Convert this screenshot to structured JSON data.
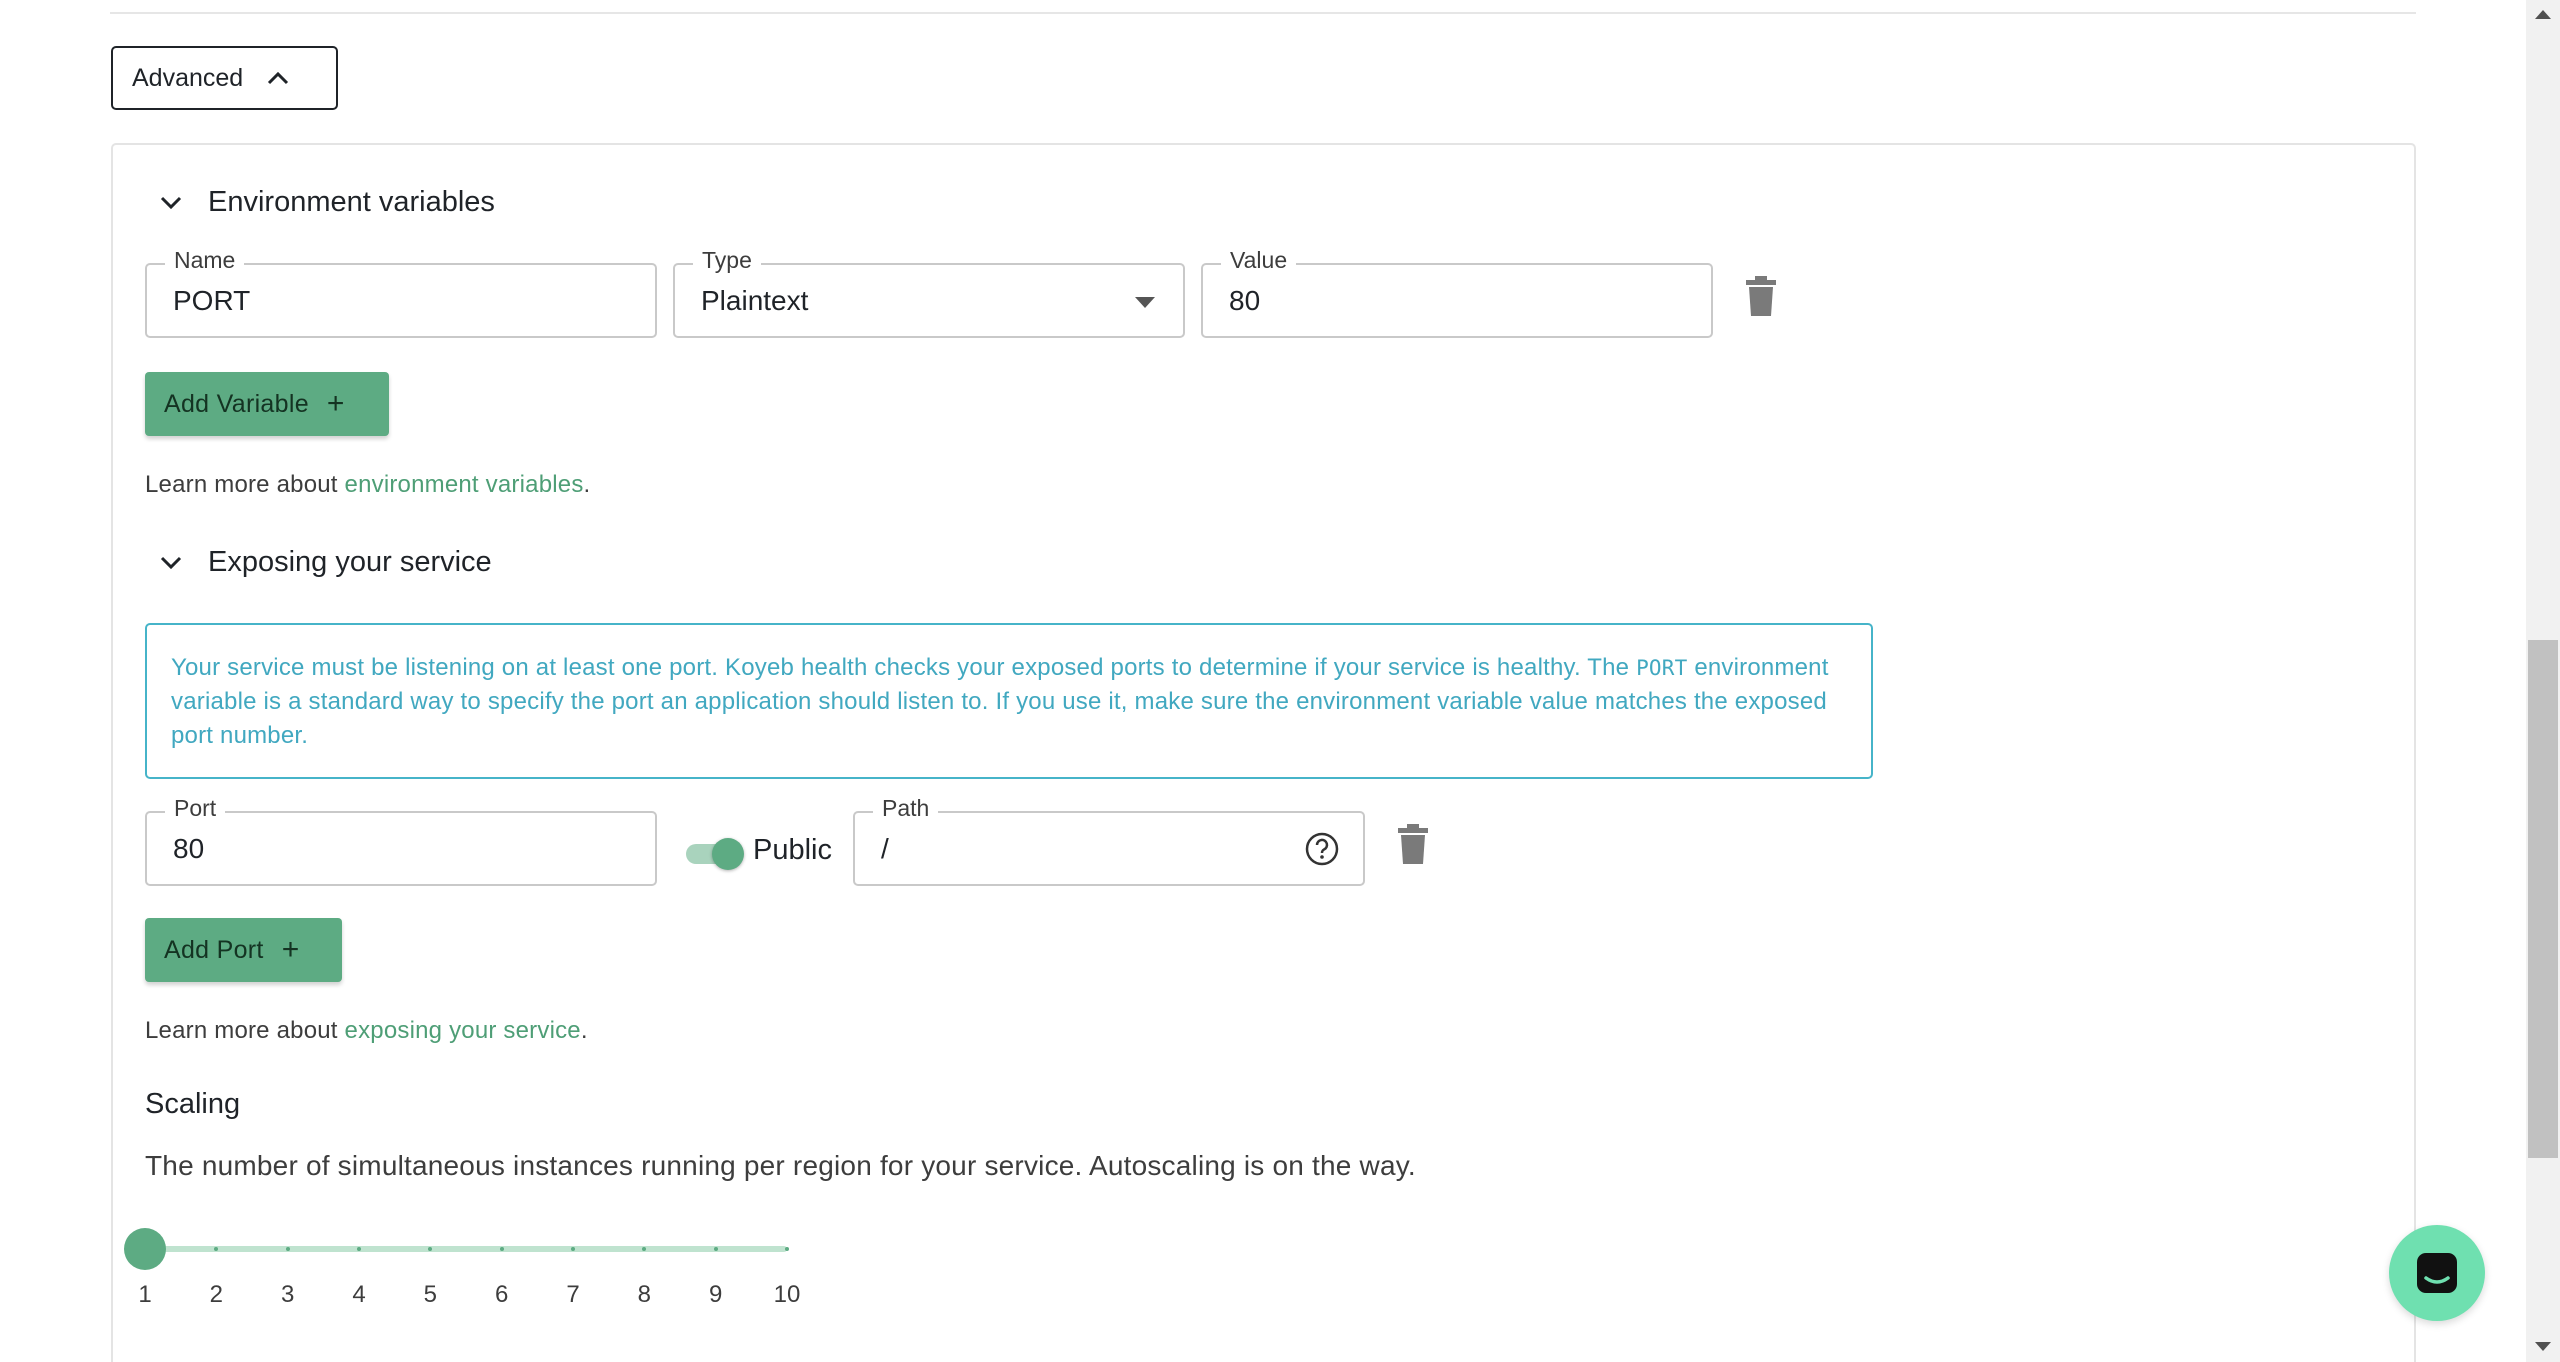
{
  "advanced": {
    "label": "Advanced"
  },
  "env": {
    "title": "Environment variables",
    "name_label": "Name",
    "name_value": "PORT",
    "type_label": "Type",
    "type_value": "Plaintext",
    "value_label": "Value",
    "value_value": "80",
    "add_label": "Add Variable",
    "learn_prefix": "Learn more about ",
    "learn_link": "environment variables",
    "learn_suffix": "."
  },
  "expose": {
    "title": "Exposing your service",
    "info_part1": "Your service must be listening on at least one port. Koyeb health checks your exposed ports to determine if your service is healthy. The ",
    "info_code": "PORT",
    "info_part2": " environment variable is a standard way to specify the port an application should listen to. If you use it, make sure the environment variable value matches the exposed port number.",
    "port_label": "Port",
    "port_value": "80",
    "public_label": "Public",
    "public_on": true,
    "path_label": "Path",
    "path_value": "/",
    "add_label": "Add Port",
    "learn_prefix": "Learn more about ",
    "learn_link": "exposing your service",
    "learn_suffix": "."
  },
  "scaling": {
    "title": "Scaling",
    "description": "The number of simultaneous instances running per region for your service. Autoscaling is on the way.",
    "value": 1,
    "min": 1,
    "max": 10,
    "ticks": [
      "1",
      "2",
      "3",
      "4",
      "5",
      "6",
      "7",
      "8",
      "9",
      "10"
    ]
  },
  "colors": {
    "accent": "#5dab83",
    "info": "#41a8c0",
    "chat": "#6fe0b0"
  },
  "icons": {
    "advanced": "chevron-up-icon",
    "section": "chevron-down-icon",
    "delete": "trash-icon",
    "help": "help-circle-icon",
    "chat": "chat-icon"
  }
}
